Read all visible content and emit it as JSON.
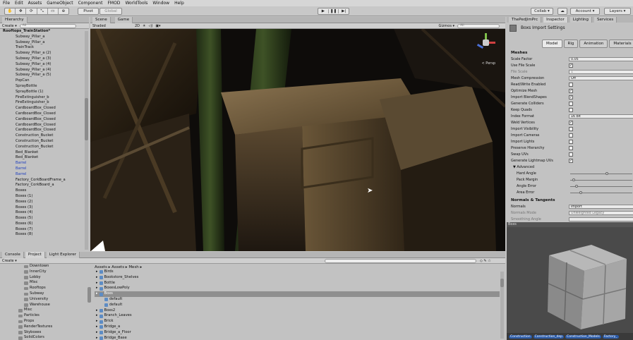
{
  "menu": [
    "File",
    "Edit",
    "Assets",
    "GameObject",
    "Component",
    "FMOD",
    "WorldTools",
    "Window",
    "Help"
  ],
  "toolbar": {
    "tools": [
      "✋",
      "✥",
      "⟳",
      "⤡",
      "▭",
      "⊕"
    ],
    "pivot": "Pivot",
    "global": "Global",
    "collab": "Collab ▾",
    "account": "Account ▾",
    "layers": "Layers ▾"
  },
  "hierarchy": {
    "tab": "Hierarchy",
    "create": "Create ▾",
    "search_placeholder": "All",
    "root": "Rooftops_TrainStation*",
    "items": [
      {
        "label": "Subway_Pillar_a",
        "blue": false
      },
      {
        "label": "Subway_Pillar_a",
        "blue": false
      },
      {
        "label": "TrainTrack",
        "blue": false
      },
      {
        "label": "Subway_Pillar_a (2)",
        "blue": false
      },
      {
        "label": "Subway_Pillar_a (3)",
        "blue": false
      },
      {
        "label": "Subway_Pillar_a (4)",
        "blue": false
      },
      {
        "label": "Subway_Pillar_a (4)",
        "blue": false
      },
      {
        "label": "Subway_Pillar_a (5)",
        "blue": false
      },
      {
        "label": "PopCan",
        "blue": false
      },
      {
        "label": "SprayBottle",
        "blue": false
      },
      {
        "label": "SprayBottle (1)",
        "blue": false
      },
      {
        "label": "FireExtinguisher_b",
        "blue": false
      },
      {
        "label": "FireExtinguisher_b",
        "blue": false
      },
      {
        "label": "CardboardBox_Closed",
        "blue": false
      },
      {
        "label": "CardboardBox_Closed",
        "blue": false
      },
      {
        "label": "CardboardBox_Closed",
        "blue": false
      },
      {
        "label": "CardboardBox_Closed",
        "blue": false
      },
      {
        "label": "CardboardBox_Closed",
        "blue": false
      },
      {
        "label": "Construction_Bucket",
        "blue": false
      },
      {
        "label": "Construction_Bucket",
        "blue": false
      },
      {
        "label": "Construction_Bucket",
        "blue": false
      },
      {
        "label": "Bed_Blanket",
        "blue": false
      },
      {
        "label": "Bed_Blanket",
        "blue": false
      },
      {
        "label": "Barrel",
        "blue": true
      },
      {
        "label": "Barrel",
        "blue": true
      },
      {
        "label": "Barrel",
        "blue": true
      },
      {
        "label": "Factory_CorkBoardFrame_a",
        "blue": false
      },
      {
        "label": "Factory_CorkBoard_a",
        "blue": false
      },
      {
        "label": "Boxes",
        "blue": false
      },
      {
        "label": "Boxes (1)",
        "blue": false
      },
      {
        "label": "Boxes (2)",
        "blue": false
      },
      {
        "label": "Boxes (3)",
        "blue": false
      },
      {
        "label": "Boxes (4)",
        "blue": false
      },
      {
        "label": "Boxes (5)",
        "blue": false
      },
      {
        "label": "Boxes (6)",
        "blue": false
      },
      {
        "label": "Boxes (7)",
        "blue": false
      },
      {
        "label": "Boxes (8)",
        "blue": false
      }
    ]
  },
  "scene": {
    "tab_scene": "Scene",
    "tab_game": "Game",
    "shading": "Shaded",
    "mode_2d": "2D",
    "gizmos": "Gizmos ▾",
    "search_placeholder": "All",
    "persp": "< Persp"
  },
  "inspector": {
    "tabs": [
      "ThePedJimPrc",
      "Inspector",
      "Lighting",
      "Services"
    ],
    "title": "Boxs Import Settings",
    "subtabs": [
      "Model",
      "Rig",
      "Animation",
      "Materials"
    ],
    "section_meshes": "Meshes",
    "props": [
      {
        "label": "Scale Factor",
        "kind": "field",
        "value": "0.05"
      },
      {
        "label": "Use File Scale",
        "kind": "check",
        "value": "✓"
      },
      {
        "label": "File Scale",
        "kind": "field",
        "value": "1",
        "dim": true
      },
      {
        "label": "Mesh Compression",
        "kind": "field",
        "value": "Off"
      },
      {
        "label": "Read/Write Enabled",
        "kind": "check",
        "value": ""
      },
      {
        "label": "Optimize Mesh",
        "kind": "check",
        "value": "✓"
      },
      {
        "label": "Import BlendShapes",
        "kind": "check",
        "value": "✓"
      },
      {
        "label": "Generate Colliders",
        "kind": "check",
        "value": ""
      },
      {
        "label": "Keep Quads",
        "kind": "check",
        "value": ""
      },
      {
        "label": "Index Format",
        "kind": "field",
        "value": "16 bit"
      },
      {
        "label": "Weld Vertices",
        "kind": "check",
        "value": "✓"
      },
      {
        "label": "Import Visibility",
        "kind": "check",
        "value": ""
      },
      {
        "label": "Import Cameras",
        "kind": "check",
        "value": ""
      },
      {
        "label": "Import Lights",
        "kind": "check",
        "value": ""
      },
      {
        "label": "Preserve Hierarchy",
        "kind": "check",
        "value": ""
      },
      {
        "label": "Swap UVs",
        "kind": "check",
        "value": ""
      },
      {
        "label": "Generate Lightmap UVs",
        "kind": "check",
        "value": "✓"
      },
      {
        "label": "▼ Advanced",
        "kind": "none",
        "value": ""
      },
      {
        "label": "Hard Angle",
        "kind": "slider",
        "value": 0.6
      },
      {
        "label": "Pack Margin",
        "kind": "slider",
        "value": 0.04
      },
      {
        "label": "Angle Error",
        "kind": "slider",
        "value": 0.08
      },
      {
        "label": "Area Error",
        "kind": "slider",
        "value": 0.15
      }
    ],
    "section_normals": "Normals & Tangents",
    "normals": [
      {
        "label": "Normals",
        "value": "Import"
      },
      {
        "label": "Normals Mode",
        "value": "Unweighted Legacy"
      },
      {
        "label": "Smoothing Angle",
        "value": ""
      }
    ]
  },
  "preview": {
    "title": "Boxs",
    "tags": [
      "Construction",
      "Construction_dep",
      "Construction_Models",
      "Factory_"
    ]
  },
  "bottom": {
    "tabs": [
      "Console",
      "Project",
      "Light Explorer"
    ],
    "create": "Create ▾",
    "breadcrumb": "Assets ▸ Assets ▸ Mesh ▸",
    "folders": [
      {
        "label": "Downtown",
        "indent": 1
      },
      {
        "label": "InnerCity",
        "indent": 1
      },
      {
        "label": "Lobby",
        "indent": 1
      },
      {
        "label": "Misc",
        "indent": 1
      },
      {
        "label": "Rooftops",
        "indent": 1
      },
      {
        "label": "Subway",
        "indent": 1
      },
      {
        "label": "University",
        "indent": 1
      },
      {
        "label": "Warehouse",
        "indent": 1
      },
      {
        "label": "Misc",
        "indent": 0
      },
      {
        "label": "Particles",
        "indent": 0
      },
      {
        "label": "Props",
        "indent": 0
      },
      {
        "label": "RenderTextures",
        "indent": 0
      },
      {
        "label": "Skyboxes",
        "indent": 0
      },
      {
        "label": "SolidColors",
        "indent": 0
      }
    ],
    "assets": [
      {
        "label": "Birds",
        "indent": 0,
        "sel": false
      },
      {
        "label": "Bookstore_Shelves",
        "indent": 0,
        "sel": false
      },
      {
        "label": "Bottle",
        "indent": 0,
        "sel": false
      },
      {
        "label": "BoxesLowPoly",
        "indent": 0,
        "sel": false
      },
      {
        "label": "Boxs",
        "indent": 0,
        "sel": true
      },
      {
        "label": "default",
        "indent": 1,
        "sel": false
      },
      {
        "label": "default",
        "indent": 1,
        "sel": false
      },
      {
        "label": "Boxs2",
        "indent": 0,
        "sel": false
      },
      {
        "label": "Branch_Leaves",
        "indent": 0,
        "sel": false
      },
      {
        "label": "Brick",
        "indent": 0,
        "sel": false
      },
      {
        "label": "Bridge_a",
        "indent": 0,
        "sel": false
      },
      {
        "label": "Bridge_a_Floor",
        "indent": 0,
        "sel": false
      },
      {
        "label": "Bridge_Base",
        "indent": 0,
        "sel": false
      }
    ]
  }
}
